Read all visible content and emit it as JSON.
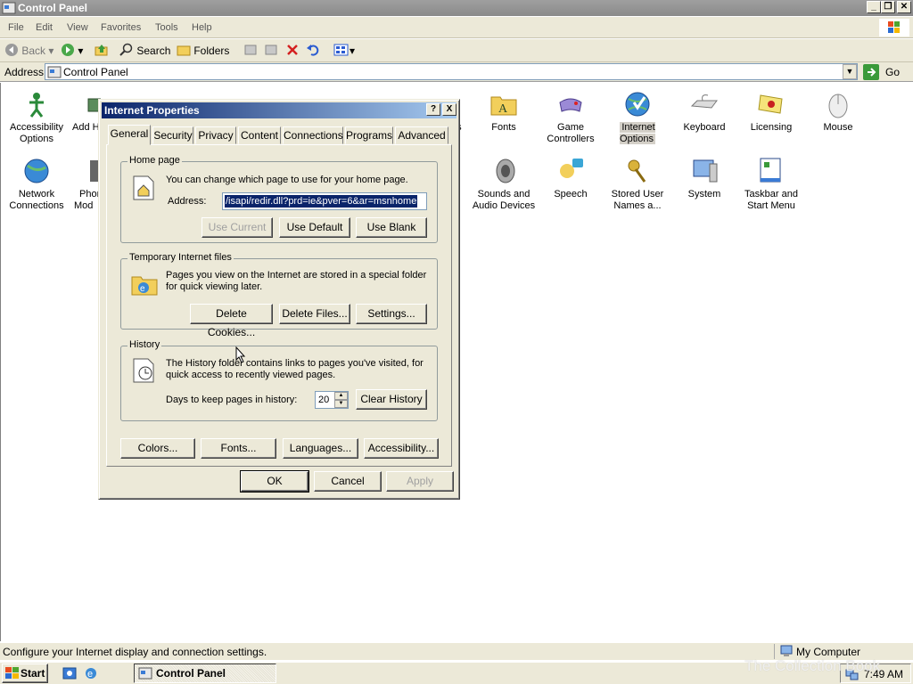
{
  "window": {
    "title": "Control Panel"
  },
  "menu": [
    "File",
    "Edit",
    "View",
    "Favorites",
    "Tools",
    "Help"
  ],
  "toolbar": {
    "back": "Back",
    "search": "Search",
    "folders": "Folders"
  },
  "address": {
    "label": "Address",
    "value": "Control Panel",
    "go": "Go"
  },
  "items": [
    {
      "label": "Accessibility Options"
    },
    {
      "label": "Add H"
    },
    {
      "label": "ns"
    },
    {
      "label": "Fonts"
    },
    {
      "label": "Game Controllers"
    },
    {
      "label": "Internet Options"
    },
    {
      "label": "Keyboard"
    },
    {
      "label": "Licensing"
    },
    {
      "label": "Mouse"
    },
    {
      "label": "Network Connections"
    },
    {
      "label": "Phon Mod"
    },
    {
      "label": "Sounds and Audio Devices"
    },
    {
      "label": "Speech"
    },
    {
      "label": "Stored User Names a..."
    },
    {
      "label": "System"
    },
    {
      "label": "Taskbar and Start Menu"
    }
  ],
  "dialog": {
    "title": "Internet Properties",
    "help": "?",
    "close": "X",
    "tabs": [
      "General",
      "Security",
      "Privacy",
      "Content",
      "Connections",
      "Programs",
      "Advanced"
    ],
    "homepage": {
      "group": "Home page",
      "desc": "You can change which page to use for your home page.",
      "address_label": "Address:",
      "address_value": "/isapi/redir.dll?prd=ie&pver=6&ar=msnhome",
      "use_current": "Use Current",
      "use_default": "Use Default",
      "use_blank": "Use Blank"
    },
    "tif": {
      "group": "Temporary Internet files",
      "desc": "Pages you view on the Internet are stored in a special folder for quick viewing later.",
      "delete_cookies": "Delete Cookies...",
      "delete_files": "Delete Files...",
      "settings": "Settings..."
    },
    "history": {
      "group": "History",
      "desc": "The History folder contains links to pages you've visited, for quick access to recently viewed pages.",
      "days_label": "Days to keep pages in history:",
      "days_value": "20",
      "clear": "Clear History"
    },
    "bottom": {
      "colors": "Colors...",
      "fonts": "Fonts...",
      "languages": "Languages...",
      "accessibility": "Accessibility..."
    },
    "ok": "OK",
    "cancel": "Cancel",
    "apply": "Apply"
  },
  "status": {
    "text": "Configure your Internet display and connection settings.",
    "zone": "My Computer"
  },
  "taskbar": {
    "start": "Start",
    "task": "Control Panel",
    "clock": "7:49 AM"
  },
  "watermark": "The Collection Book",
  "colors": {
    "accent": "#0a246a",
    "dialog_bg": "#ece9d8",
    "title_gray": "#9f9f9f"
  }
}
